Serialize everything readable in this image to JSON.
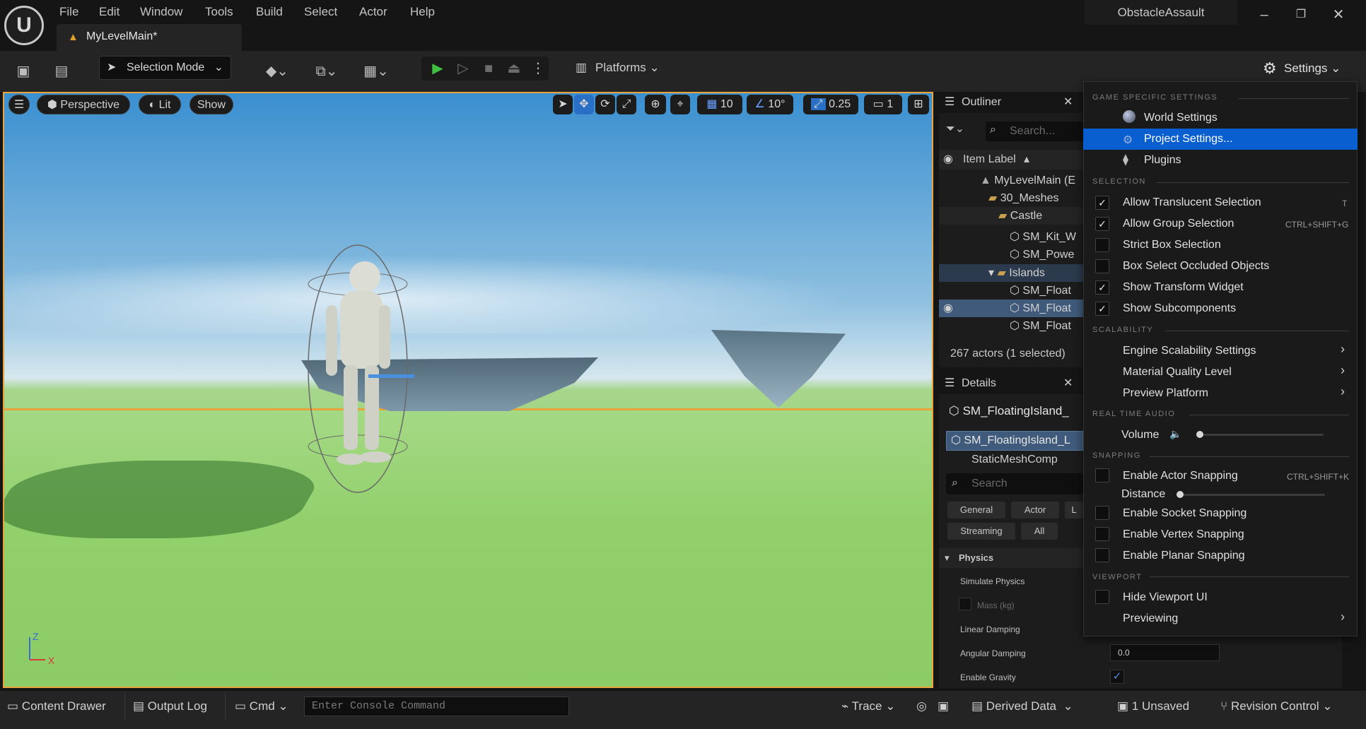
{
  "menu": [
    "File",
    "Edit",
    "Window",
    "Tools",
    "Build",
    "Select",
    "Actor",
    "Help"
  ],
  "document_tab": "MyLevelMain*",
  "project_name": "ObstacleAssault",
  "toolbar": {
    "selection_mode": "Selection Mode",
    "platforms": "Platforms",
    "settings": "Settings"
  },
  "viewport": {
    "perspective": "Perspective",
    "lit": "Lit",
    "show": "Show",
    "grid_snap": "10",
    "rotation_snap": "10°",
    "scale_snap": "0.25",
    "camera_speed": "1",
    "axis_z": "Z",
    "axis_x": "X"
  },
  "outliner": {
    "title": "Outliner",
    "search_placeholder": "Search...",
    "column": "Item Label",
    "items": [
      "MyLevelMain (E",
      "30_Meshes",
      "Castle",
      "SM_Kit_W",
      "SM_Powe",
      "Islands",
      "SM_Float",
      "SM_Float",
      "SM_Float"
    ],
    "summary": "267 actors (1 selected)"
  },
  "details": {
    "title": "Details",
    "actor_name": "SM_FloatingIsland_",
    "component_root": "SM_FloatingIsland_L",
    "component_child": "StaticMeshComp",
    "search_placeholder": "Search",
    "filters": [
      "General",
      "Actor",
      "L",
      "Streaming",
      "All"
    ],
    "section": "Physics",
    "properties": [
      "Simulate Physics",
      "Mass (kg)",
      "Linear Damping",
      "Angular Damping",
      "Enable Gravity"
    ],
    "angular_damping_value": "0.0"
  },
  "settings_menu": {
    "game_specific_header": "GAME SPECIFIC SETTINGS",
    "world_settings": "World Settings",
    "project_settings": "Project Settings...",
    "plugins": "Plugins",
    "selection_header": "SELECTION",
    "allow_translucent": "Allow Translucent Selection",
    "allow_translucent_shortcut": "T",
    "allow_group": "Allow Group Selection",
    "allow_group_shortcut": "CTRL+SHIFT+G",
    "strict_box": "Strict Box Selection",
    "box_occluded": "Box Select Occluded Objects",
    "show_transform": "Show Transform Widget",
    "show_subcomponents": "Show Subcomponents",
    "scalability_header": "SCALABILITY",
    "engine_scalability": "Engine Scalability Settings",
    "material_quality": "Material Quality Level",
    "preview_platform": "Preview Platform",
    "realtime_audio_header": "REAL TIME AUDIO",
    "volume": "Volume",
    "snapping_header": "SNAPPING",
    "enable_actor_snapping": "Enable Actor Snapping",
    "enable_actor_snapping_shortcut": "CTRL+SHIFT+K",
    "distance": "Distance",
    "enable_socket_snapping": "Enable Socket Snapping",
    "enable_vertex_snapping": "Enable Vertex Snapping",
    "enable_planar_snapping": "Enable Planar Snapping",
    "viewport_header": "VIEWPORT",
    "hide_viewport_ui": "Hide Viewport UI",
    "previewing": "Previewing"
  },
  "bottom": {
    "content_drawer": "Content Drawer",
    "output_log": "Output Log",
    "cmd": "Cmd",
    "console_placeholder": "Enter Console Command",
    "trace": "Trace",
    "derived_data": "Derived Data",
    "unsaved": "1 Unsaved",
    "revision_control": "Revision Control"
  },
  "colors": {
    "accent": "#2a6fc6",
    "highlight": "#0a5fd0",
    "selection_outline": "#e8a33a"
  }
}
